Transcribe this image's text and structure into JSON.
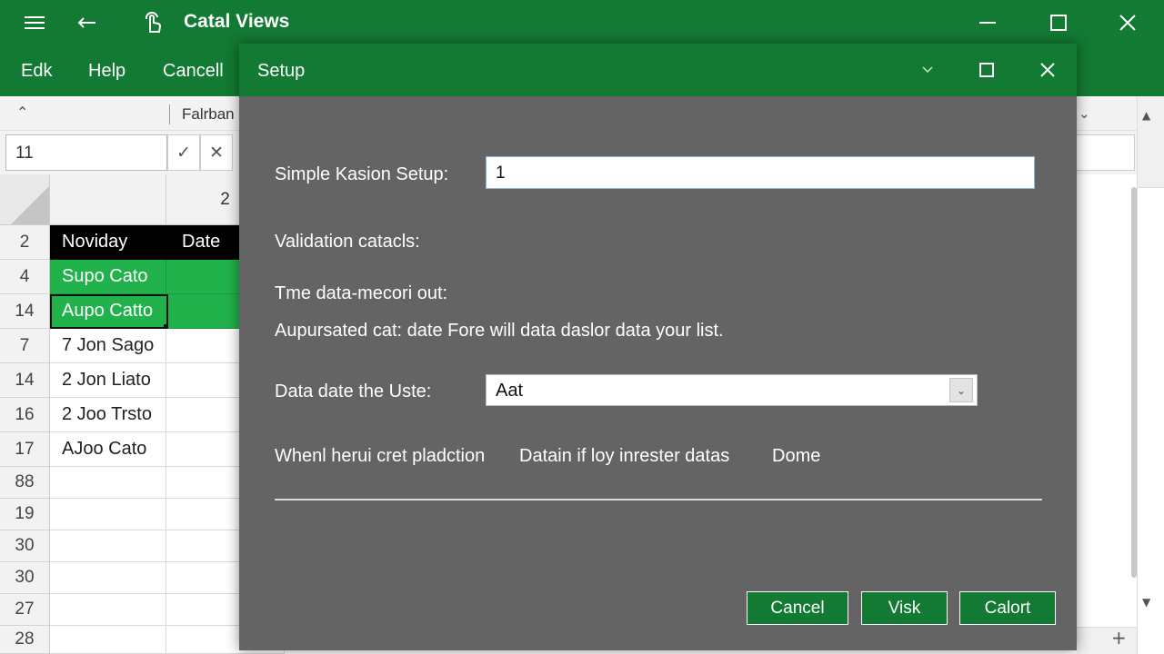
{
  "window": {
    "title": "Catal Views",
    "icons": [
      "hamburger-menu-icon",
      "back-arrow-icon",
      "touch-pointer-icon",
      "minimize-icon",
      "maximize-icon",
      "close-icon"
    ]
  },
  "menu": {
    "items": [
      "Edk",
      "Help",
      "Cancell"
    ]
  },
  "ribbon": {
    "font_name": "Falrban"
  },
  "formula_bar": {
    "name_box": "11",
    "confirm_symbol": "✓",
    "cancel_symbol": "✕"
  },
  "grid": {
    "column_headers": [
      "2"
    ],
    "rows": [
      {
        "num": "2",
        "a": "Noviday",
        "b": "Date",
        "style": "header"
      },
      {
        "num": "4",
        "a": "Supo Cato",
        "b": "",
        "style": "green"
      },
      {
        "num": "14",
        "a": "Aupo Catto",
        "b": "",
        "style": "green-active"
      },
      {
        "num": "7",
        "a": "7 Jon Sago",
        "b": "",
        "style": "normal"
      },
      {
        "num": "14",
        "a": "2 Jon Liato",
        "b": "",
        "style": "normal"
      },
      {
        "num": "16",
        "a": "2 Joo Trsto",
        "b": "",
        "style": "normal"
      },
      {
        "num": "17",
        "a": "AJoo Cato",
        "b": "",
        "style": "normal"
      },
      {
        "num": "88",
        "a": "",
        "b": "",
        "style": "normal"
      },
      {
        "num": "19",
        "a": "",
        "b": "",
        "style": "normal"
      },
      {
        "num": "30",
        "a": "",
        "b": "",
        "style": "normal"
      },
      {
        "num": "30",
        "a": "",
        "b": "",
        "style": "normal"
      },
      {
        "num": "27",
        "a": "",
        "b": "",
        "style": "normal"
      },
      {
        "num": "28",
        "a": "",
        "b": "",
        "style": "normal"
      }
    ]
  },
  "dialog": {
    "title": "Setup",
    "setup_label": "Simple Kasion Setup:",
    "setup_value": "1",
    "validation_label": "Validation catacls:",
    "time_label": "Tme data-mecori out:",
    "description": "Aupursated cat: date Fore will data daslor data your list.",
    "data_date_label": "Data date the Uste:",
    "data_date_value": "Aat",
    "option_1": "Whenl herui cret pladction",
    "option_2": "Datain if loy inrester datas",
    "option_3": "Dome",
    "buttons": {
      "cancel": "Cancel",
      "visk": "Visk",
      "calort": "Calort"
    }
  },
  "colors": {
    "brand_green": "#127a32",
    "row_green": "#21b24c",
    "dialog_bg": "#646464"
  }
}
